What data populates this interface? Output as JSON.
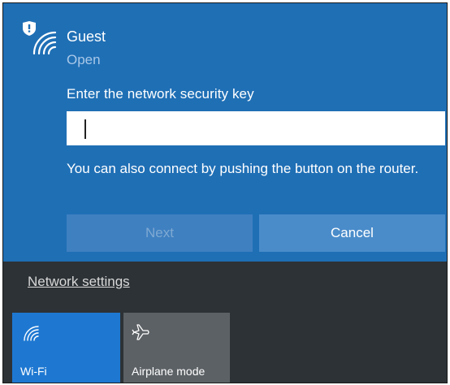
{
  "network": {
    "name": "Guest",
    "status": "Open",
    "prompt": "Enter the network security key",
    "key_value": "",
    "hint": "You can also connect by pushing the button on the router."
  },
  "buttons": {
    "next_label": "Next",
    "cancel_label": "Cancel"
  },
  "settings_link": "Network settings",
  "quick_actions": [
    {
      "label": "Wi-Fi",
      "icon": "wifi-icon",
      "active": true
    },
    {
      "label": "Airplane mode",
      "icon": "airplane-icon",
      "active": false
    }
  ],
  "colors": {
    "accent": "#1f6fb5",
    "tile_active": "#1e78d2",
    "tile_inactive": "#5c6165",
    "taskbar_bg": "#2d3236"
  }
}
